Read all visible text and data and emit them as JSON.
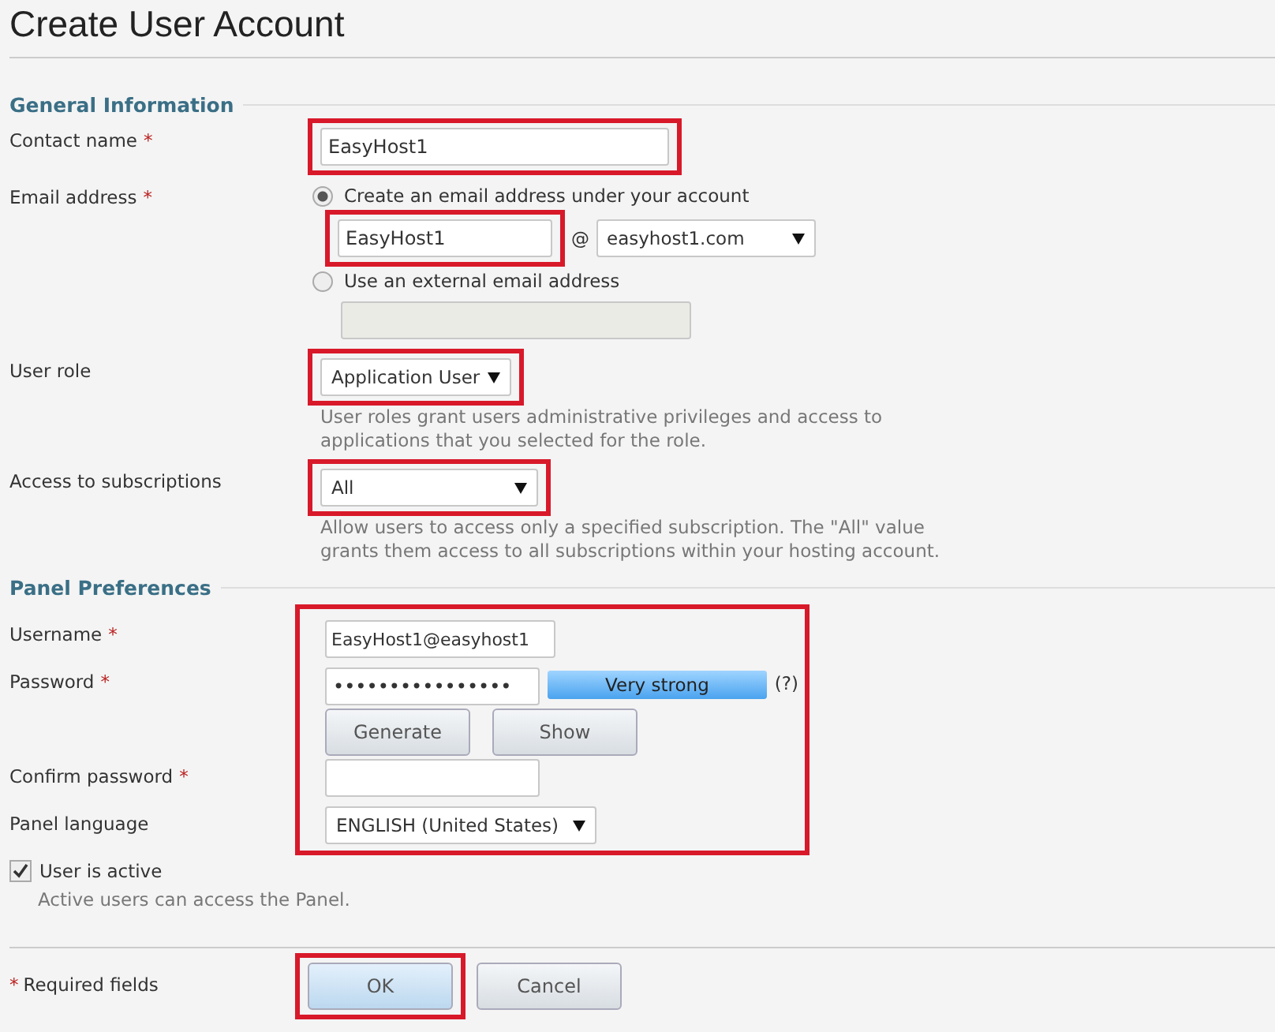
{
  "title": "Create User Account",
  "general": {
    "heading": "General Information",
    "contact": {
      "label": "Contact name",
      "mark": "*",
      "value": "EasyHost1",
      "highlighted": true
    },
    "email": {
      "label": "Email address",
      "mark": "*",
      "options": [
        {
          "label": "Create an email address under your account",
          "selected": true
        },
        {
          "label": "Use an external email address",
          "selected": false
        }
      ],
      "local_part": "EasyHost1",
      "local_highlighted": true,
      "at": "@",
      "domain": "easyhost1.com"
    },
    "role": {
      "label": "User role",
      "value": "Application User",
      "highlighted": true,
      "help": "User roles grant users administrative privileges and access to applications that you selected for the role."
    },
    "subscriptions": {
      "label": "Access to subscriptions",
      "value": "All",
      "highlighted": true,
      "help": "Allow users to access only a specified subscription. The \"All\" value grants them access to all subscriptions within your hosting account."
    }
  },
  "panel": {
    "heading": "Panel Preferences",
    "highlighted": true,
    "username": {
      "label": "Username",
      "mark": "*",
      "value": "EasyHost1@easyhost1"
    },
    "password": {
      "label": "Password",
      "mark": "*",
      "value": "••••••••••••••••",
      "strength": "Very strong",
      "level": 1,
      "hint": "(?)"
    },
    "buttons": [
      "Generate",
      "Show"
    ],
    "confirm": {
      "label": "Confirm password",
      "mark": "*"
    },
    "language": {
      "label": "Panel language",
      "value": "ENGLISH (United States)"
    }
  },
  "active": {
    "label": "User is active",
    "checked": true,
    "help": "Active users can access the Panel."
  },
  "footer": {
    "mark": "*",
    "note": "Required fields",
    "buttons": [
      {
        "label": "OK",
        "primary": true,
        "highlighted": true
      },
      {
        "label": "Cancel",
        "primary": false,
        "highlighted": false
      }
    ]
  }
}
